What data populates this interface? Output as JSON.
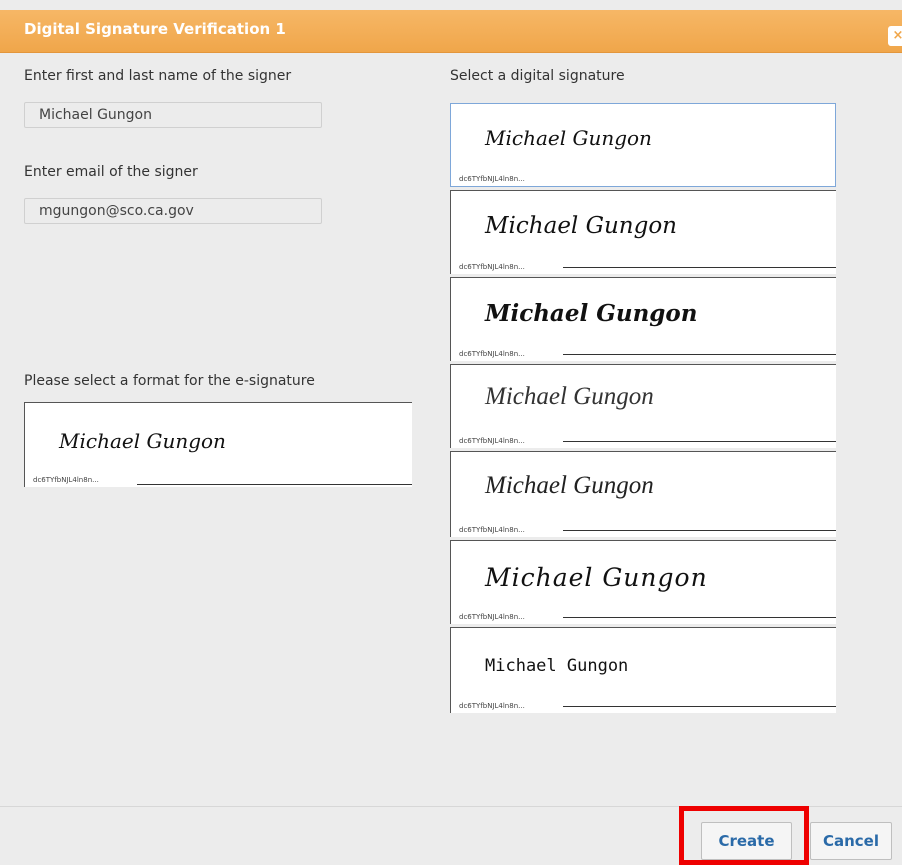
{
  "dialog": {
    "title": "Digital Signature Verification 1",
    "close_glyph": "×"
  },
  "form": {
    "name_label": "Enter first and last name of the signer",
    "name_value": "Michael Gungon",
    "email_label": "Enter email of the signer",
    "email_value": "mgungon@sco.ca.gov",
    "format_label": "Please select a format for the e-signature"
  },
  "signatures": {
    "label": "Select a digital signature",
    "signer": "Michael Gungon",
    "id_text": "dc6TYfbNJL4ln8n...",
    "selected_index": 0,
    "options": [
      {
        "text": "Michael Gungon"
      },
      {
        "text": "Michael Gungon"
      },
      {
        "text": "Michael Gungon"
      },
      {
        "text": "Michael Gungon"
      },
      {
        "text": "Michael Gungon"
      },
      {
        "text": "Michael Gungon"
      },
      {
        "text": "Michael Gungon"
      }
    ]
  },
  "preview": {
    "text": "Michael Gungon",
    "id_text": "dc6TYfbNJL4ln8n..."
  },
  "footer": {
    "create_label": "Create",
    "cancel_label": "Cancel"
  },
  "colors": {
    "titlebar": "#f0a64a",
    "highlight": "#ee0000",
    "button_text": "#2a6aa8"
  }
}
